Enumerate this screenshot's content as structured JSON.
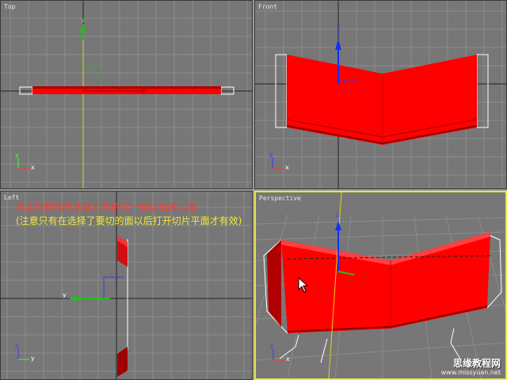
{
  "viewports": {
    "top": {
      "label": "Top"
    },
    "front": {
      "label": "Front"
    },
    "left": {
      "label": "Left"
    },
    "perspective": {
      "label": "Perspective"
    }
  },
  "axes": {
    "x": "x",
    "y": "y",
    "z": "z"
  },
  "annotation": {
    "line1": "再用同样的方法在对称的另一端切出新片段",
    "line2": "(注意只有在选择了要切的面以后打开切片平面才有效)"
  },
  "watermark": {
    "site": "思缘教程网",
    "url": "www.missyuan.net"
  },
  "colors": {
    "object": "#ff0000",
    "grid": "#8c8c8c",
    "active_border": "#e8e840",
    "annotation_red": "#ff3b2f",
    "annotation_yellow": "#f2ea3a"
  }
}
